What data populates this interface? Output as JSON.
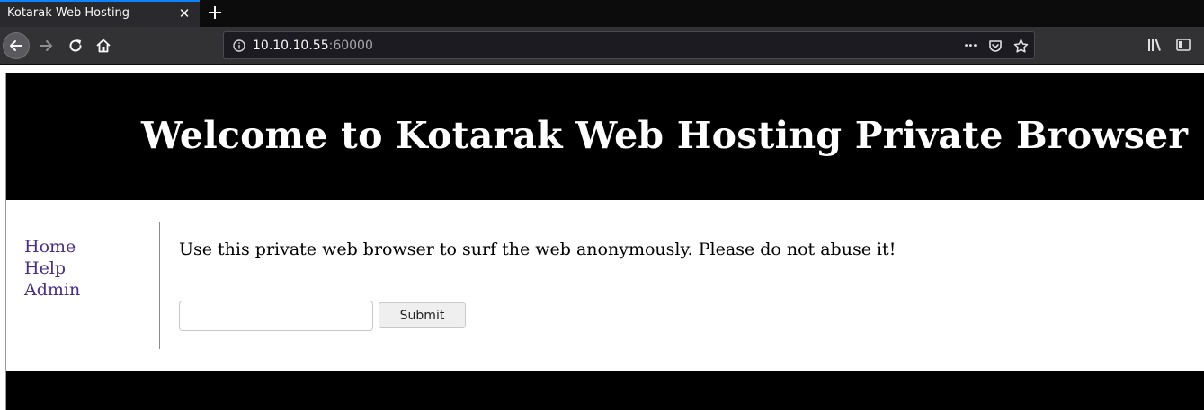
{
  "browser": {
    "tab_title": "Kotarak Web Hosting",
    "close_glyph": "✕",
    "url_host": "10.10.10.55",
    "url_port": ":60000",
    "page_actions_glyph": "•••",
    "accent": "#0a84ff"
  },
  "page": {
    "heading": "Welcome to Kotarak Web Hosting Private Browser",
    "nav": {
      "home": "Home",
      "help": "Help",
      "admin": "Admin"
    },
    "intro": "Use this private web browser to surf the web anonymously. Please do not abuse it!",
    "form": {
      "url_value": "",
      "submit_label": "Submit"
    },
    "link_color": "#4b2e83"
  }
}
